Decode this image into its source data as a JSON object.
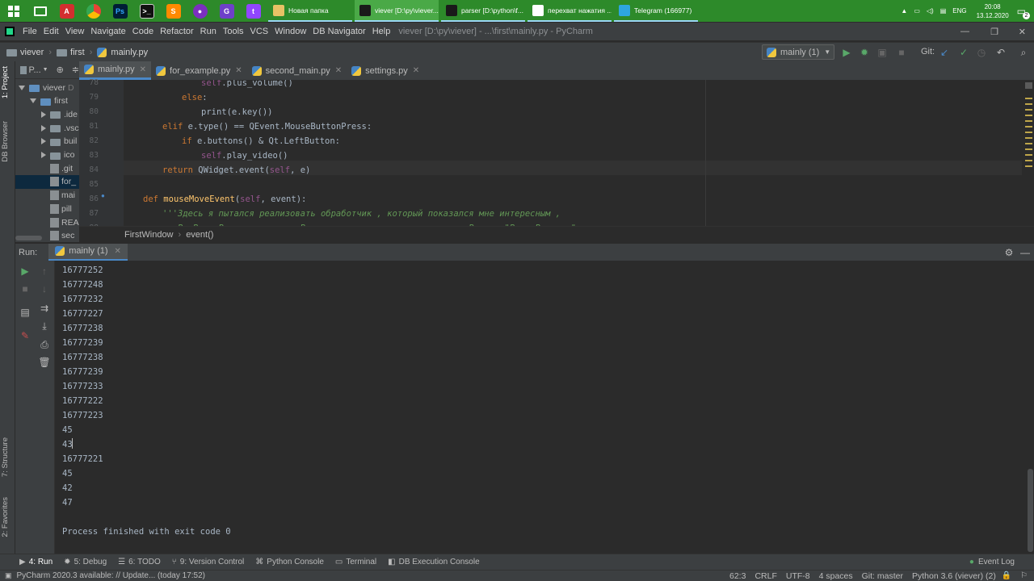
{
  "taskbar": {
    "tasks": [
      {
        "label": "Новая папка",
        "icon_color": "#e8c265",
        "icon": "folder-icon"
      },
      {
        "label": "viever [D:\\py\\viever...",
        "icon_color": "#1a1a1a",
        "icon": "pycharm-icon",
        "active": true
      },
      {
        "label": "parser [D:\\python\\f...",
        "icon_color": "#1a1a1a",
        "icon": "pycharm-icon"
      },
      {
        "label": "перехват нажатия ...",
        "icon_color": "#ffffff",
        "icon": "yandex-browser-icon"
      },
      {
        "label": "Telegram (166977)",
        "icon_color": "#2ea6de",
        "icon": "telegram-icon"
      }
    ],
    "tray": {
      "lang": "ENG",
      "time": "20:08",
      "date": "13.12.2020",
      "notifications": "2"
    }
  },
  "menubar": {
    "items": [
      "File",
      "Edit",
      "View",
      "Navigate",
      "Code",
      "Refactor",
      "Run",
      "Tools",
      "VCS",
      "Window",
      "DB Navigator",
      "Help"
    ],
    "title": "viever [D:\\py\\viever] - ...\\first\\mainly.py - PyCharm"
  },
  "navbar": {
    "crumbs": [
      "viever",
      "first",
      "mainly.py"
    ],
    "run_config": "mainly (1)",
    "git_label": "Git:"
  },
  "left_stripe": {
    "project": "1: Project",
    "db_browser": "DB Browser",
    "structure": "7: Structure",
    "favorites": "2: Favorites"
  },
  "project": {
    "header": "P...",
    "rows": [
      {
        "label": "viever",
        "suffix": "D",
        "depth": 0,
        "kind": "folder",
        "open": true
      },
      {
        "label": "first",
        "depth": 1,
        "kind": "folder",
        "open": true
      },
      {
        "label": ".ide",
        "depth": 2,
        "kind": "folder"
      },
      {
        "label": ".vsc",
        "depth": 2,
        "kind": "folder"
      },
      {
        "label": "buil",
        "depth": 2,
        "kind": "folder"
      },
      {
        "label": "ico",
        "depth": 2,
        "kind": "folder"
      },
      {
        "label": ".git",
        "depth": 2,
        "kind": "file"
      },
      {
        "label": "for_",
        "depth": 2,
        "kind": "file",
        "selected": true
      },
      {
        "label": "mai",
        "depth": 2,
        "kind": "file"
      },
      {
        "label": "pill",
        "depth": 2,
        "kind": "file"
      },
      {
        "label": "REA",
        "depth": 2,
        "kind": "file"
      },
      {
        "label": "sec",
        "depth": 2,
        "kind": "file"
      }
    ]
  },
  "tabs": [
    {
      "label": "mainly.py",
      "active": true
    },
    {
      "label": "for_example.py"
    },
    {
      "label": "second_main.py"
    },
    {
      "label": "settings.py"
    }
  ],
  "editor": {
    "lines": [
      {
        "n": "78",
        "indent": 4,
        "code": "self.plus_volume()"
      },
      {
        "n": "79",
        "indent": 3,
        "code": "else:"
      },
      {
        "n": "80",
        "indent": 4,
        "code": "print(e.key())"
      },
      {
        "n": "81",
        "indent": 2,
        "code": "elif e.type() == QEvent.MouseButtonPress:"
      },
      {
        "n": "82",
        "indent": 3,
        "code": "if e.buttons() & Qt.LeftButton:"
      },
      {
        "n": "83",
        "indent": 4,
        "code": "self.play_video()"
      },
      {
        "n": "84",
        "indent": 2,
        "code": "return QWidget.event(self, e)"
      },
      {
        "n": "85",
        "indent": 0,
        "code": ""
      },
      {
        "n": "86",
        "indent": 1,
        "code": "def mouseMoveEvent(self, event):"
      },
      {
        "n": "87",
        "indent": 2,
        "code": "'''Здесь я пытался реализовать обработчик , который показался мне интересным ,"
      },
      {
        "n": "88",
        "indent": 2,
        "code": "   В. Вере Воспроизведения Видео если курсор мыши находится Внутри \"ВидеоВиджета\""
      }
    ],
    "breadcrumb": [
      "FirstWindow",
      "event()"
    ]
  },
  "run": {
    "label": "Run:",
    "tab": "mainly (1)",
    "output": [
      "16777252",
      "16777248",
      "16777232",
      "16777227",
      "16777238",
      "16777239",
      "16777238",
      "16777239",
      "16777233",
      "16777222",
      "16777223",
      "45",
      "43",
      "16777221",
      "45",
      "42",
      "47",
      "",
      "Process finished with exit code 0"
    ]
  },
  "bottom_tabs": [
    "4: Run",
    "5: Debug",
    "6: TODO",
    "9: Version Control",
    "Python Console",
    "Terminal",
    "DB Execution Console"
  ],
  "event_log": "Event Log",
  "status": {
    "message": "PyCharm 2020.3 available: // Update... (today 17:52)",
    "position": "62:3",
    "line_sep": "CRLF",
    "encoding": "UTF-8",
    "indent": "4 spaces",
    "git": "Git: master",
    "interpreter": "Python 3.6 (viever) (2)"
  },
  "colors": {
    "accent": "#4a88c7",
    "taskbar": "#2d8a2a",
    "run_green": "#59a869"
  }
}
